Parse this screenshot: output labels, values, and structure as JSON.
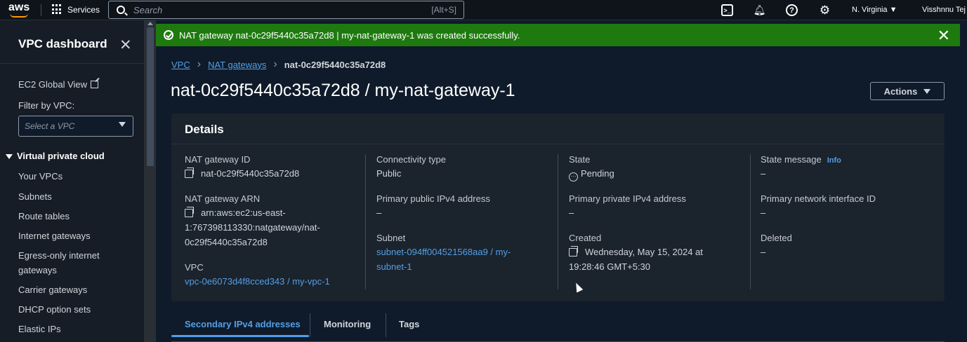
{
  "topbar": {
    "logo": "aws",
    "services_label": "Services",
    "search_placeholder": "Search",
    "search_shortcut": "[Alt+S]",
    "region": "N. Virginia ▼",
    "user": "Visshnnu Tej"
  },
  "sidebar": {
    "title": "VPC dashboard",
    "ec2_global_view": "EC2 Global View",
    "filter_label": "Filter by VPC:",
    "filter_placeholder": "Select a VPC",
    "section_title": "Virtual private cloud",
    "items": [
      "Your VPCs",
      "Subnets",
      "Route tables",
      "Internet gateways",
      "Egress-only internet gateways",
      "Carrier gateways",
      "DHCP option sets",
      "Elastic IPs"
    ]
  },
  "flash": {
    "message": "NAT gateway nat-0c29f5440c35a72d8 | my-nat-gateway-1 was created successfully.",
    "color": "#1e7a0f"
  },
  "breadcrumb": {
    "items": [
      "VPC",
      "NAT gateways",
      "nat-0c29f5440c35a72d8"
    ]
  },
  "page": {
    "title": "nat-0c29f5440c35a72d8 / my-nat-gateway-1",
    "actions_label": "Actions"
  },
  "details": {
    "header": "Details",
    "nat_gateway_id_label": "NAT gateway ID",
    "nat_gateway_id": "nat-0c29f5440c35a72d8",
    "nat_gateway_arn_label": "NAT gateway ARN",
    "nat_gateway_arn_line1": "arn:aws:ec2:us-east-",
    "nat_gateway_arn_line2": "1:767398113330:natgateway/nat-",
    "nat_gateway_arn_line3": "0c29f5440c35a72d8",
    "vpc_label": "VPC",
    "vpc": "vpc-0e6073d4f8cced343 / my-vpc-1",
    "connectivity_type_label": "Connectivity type",
    "connectivity_type": "Public",
    "primary_public_ipv4_label": "Primary public IPv4 address",
    "primary_public_ipv4": "–",
    "subnet_label": "Subnet",
    "subnet_line1": "subnet-094ff004521568aa9 / my-",
    "subnet_line2": "subnet-1",
    "state_label": "State",
    "state": "Pending",
    "primary_private_ipv4_label": "Primary private IPv4 address",
    "primary_private_ipv4": "–",
    "created_label": "Created",
    "created_line1": "Wednesday, May 15, 2024 at",
    "created_line2": "19:28:46 GMT+5:30",
    "state_message_label": "State message",
    "info_label": "Info",
    "state_message": "–",
    "primary_eni_label": "Primary network interface ID",
    "primary_eni": "–",
    "deleted_label": "Deleted",
    "deleted": "–"
  },
  "tabs": [
    "Secondary IPv4 addresses",
    "Monitoring",
    "Tags"
  ],
  "colors": {
    "link": "#539fe5",
    "background": "#0f1b2a",
    "panel": "#1b232d"
  }
}
